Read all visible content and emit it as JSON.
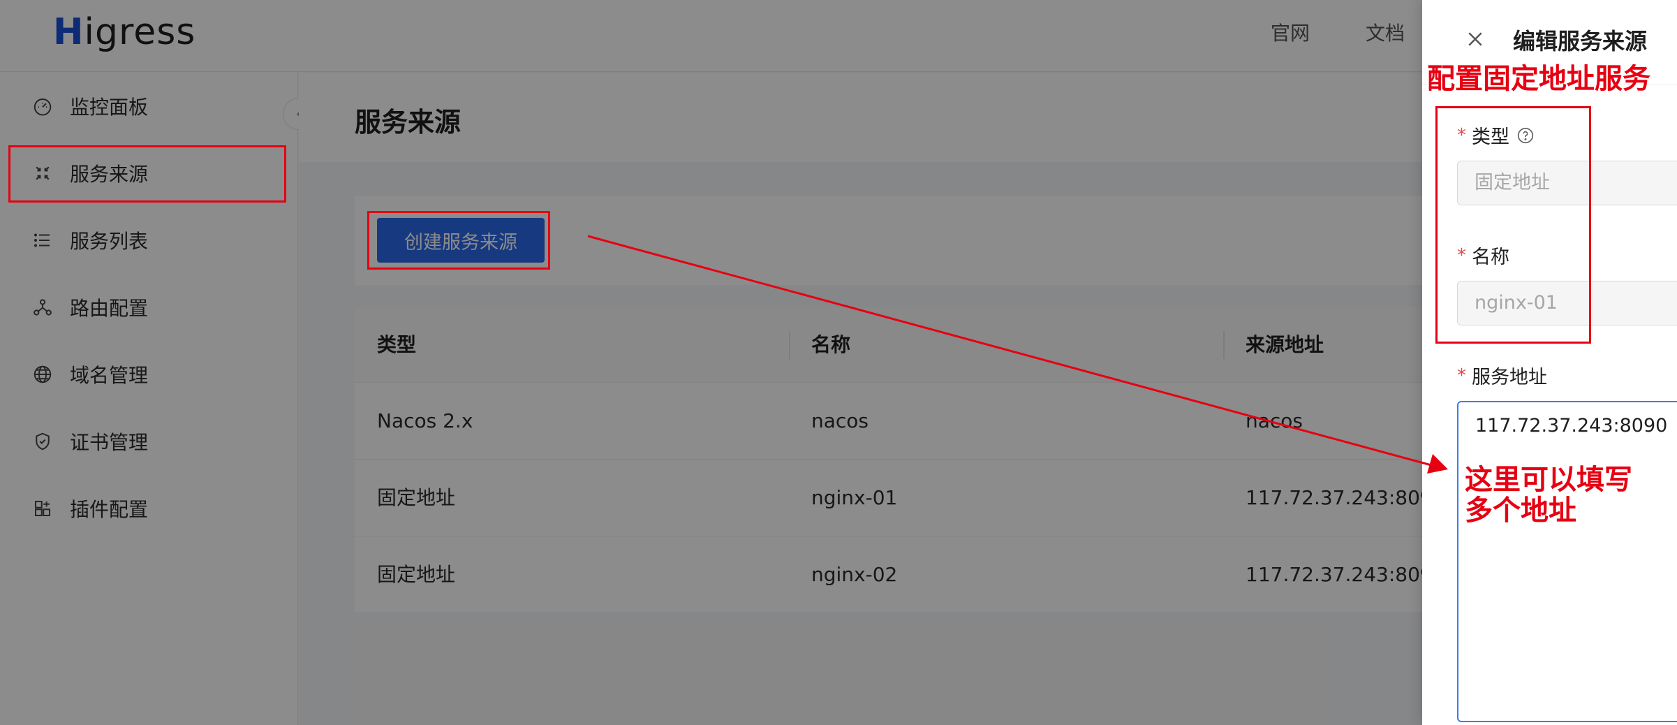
{
  "header": {
    "logo_accent": "H",
    "logo_rest": "igress",
    "nav": [
      "官网",
      "文档"
    ]
  },
  "sidebar": {
    "items": [
      {
        "label": "监控面板",
        "icon": "dashboard-icon"
      },
      {
        "label": "服务来源",
        "icon": "service-source-icon"
      },
      {
        "label": "服务列表",
        "icon": "list-icon"
      },
      {
        "label": "路由配置",
        "icon": "route-icon"
      },
      {
        "label": "域名管理",
        "icon": "globe-icon"
      },
      {
        "label": "证书管理",
        "icon": "shield-check-icon"
      },
      {
        "label": "插件配置",
        "icon": "plugin-icon"
      }
    ]
  },
  "main": {
    "title": "服务来源",
    "create_button": "创建服务来源",
    "table": {
      "columns": [
        "类型",
        "名称",
        "来源地址"
      ],
      "rows": [
        [
          "Nacos 2.x",
          "nacos",
          "nacos"
        ],
        [
          "固定地址",
          "nginx-01",
          "117.72.37.243:809"
        ],
        [
          "固定地址",
          "nginx-02",
          "117.72.37.243:809"
        ]
      ]
    }
  },
  "drawer": {
    "title": "编辑服务来源",
    "fields": {
      "type_label": "类型",
      "type_value": "固定地址",
      "name_label": "名称",
      "name_value": "nginx-01",
      "address_label": "服务地址",
      "address_value": "117.72.37.243:8090"
    }
  },
  "annotations": {
    "drawer_note": "配置固定地址服务",
    "textarea_note_line1": "这里可以填写",
    "textarea_note_line2": "多个地址"
  },
  "colors": {
    "primary": "#2a68e8",
    "annotation": "#e60012",
    "required": "#e5484d"
  }
}
